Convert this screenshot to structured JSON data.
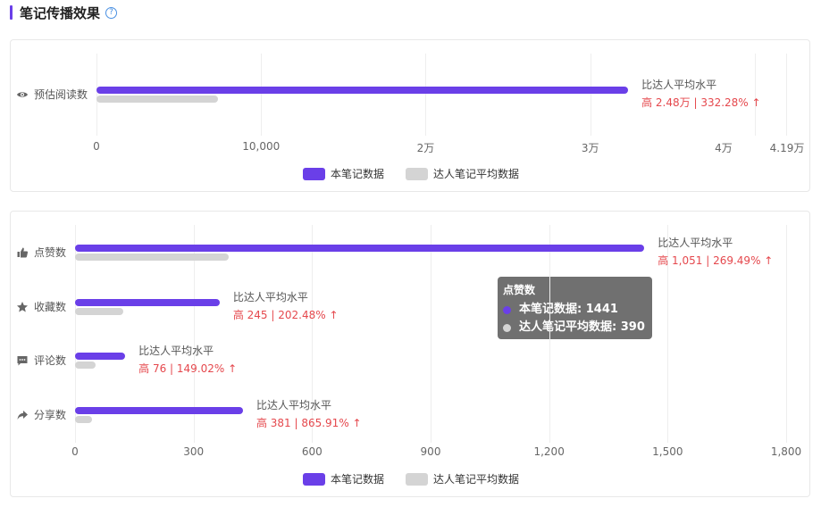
{
  "header": {
    "title": "笔记传播效果",
    "help_icon": "question-circle-icon"
  },
  "legend": {
    "main": "本笔记数据",
    "avg": "达人笔记平均数据",
    "main_color": "#6a3fe8",
    "avg_color": "#d4d4d4"
  },
  "chart_data": [
    {
      "type": "bar",
      "orientation": "horizontal",
      "categories": [
        "预估阅读数"
      ],
      "series": [
        {
          "name": "本笔记数据",
          "values": [
            32300
          ]
        },
        {
          "name": "达人笔记平均数据",
          "values": [
            7400
          ]
        }
      ],
      "xticks": [
        "0",
        "10,000",
        "2万",
        "3万",
        "4万",
        "4.19万"
      ],
      "xlim": [
        0,
        41900
      ],
      "annotations": [
        {
          "line1": "比达人平均水平",
          "line2": "高 2.48万 | 332.28% ↑"
        }
      ],
      "icons": [
        "eye-icon"
      ]
    },
    {
      "type": "bar",
      "orientation": "horizontal",
      "categories": [
        "点赞数",
        "收藏数",
        "评论数",
        "分享数"
      ],
      "series": [
        {
          "name": "本笔记数据",
          "values": [
            1441,
            366,
            127,
            425
          ]
        },
        {
          "name": "达人笔记平均数据",
          "values": [
            390,
            121,
            51,
            44
          ]
        }
      ],
      "xticks": [
        "0",
        "300",
        "600",
        "900",
        "1,200",
        "1,500",
        "1,800"
      ],
      "xlim": [
        0,
        1800
      ],
      "annotations": [
        {
          "line1": "比达人平均水平",
          "line2": "高 1,051 | 269.49% ↑"
        },
        {
          "line1": "比达人平均水平",
          "line2": "高 245 | 202.48% ↑"
        },
        {
          "line1": "比达人平均水平",
          "line2": "高 76 | 149.02% ↑"
        },
        {
          "line1": "比达人平均水平",
          "line2": "高 381 | 865.91% ↑"
        }
      ],
      "icons": [
        "thumbs-up-icon",
        "star-icon",
        "comment-icon",
        "share-icon"
      ]
    }
  ],
  "tooltip": {
    "title": "点赞数",
    "rows": [
      {
        "label": "本笔记数据: 1441",
        "color": "#6a3fe8"
      },
      {
        "label": "达人笔记平均数据: 390",
        "color": "#d4d4d4"
      }
    ]
  }
}
